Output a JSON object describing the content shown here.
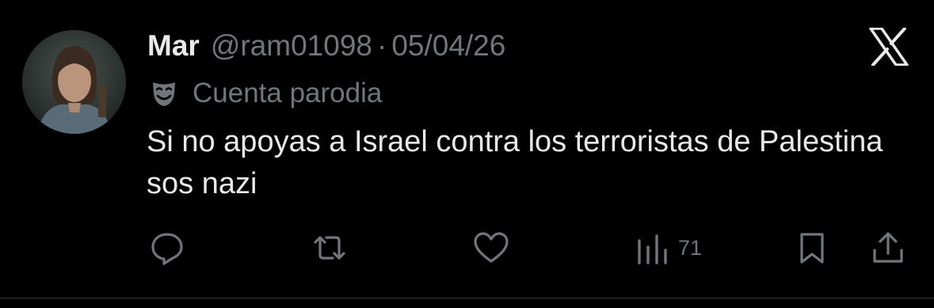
{
  "tweet": {
    "display_name": "Mar",
    "handle": "@ram01098",
    "separator": "·",
    "date": "05/04/26",
    "label": "Cuenta parodia",
    "text": "Si no apoyas a Israel contra los terroristas de Palestina sos nazi"
  },
  "actions": {
    "reply_icon": "reply-icon",
    "retweet_icon": "retweet-icon",
    "like_icon": "heart-icon",
    "views_icon": "views-bar-icon",
    "views_count": "71",
    "bookmark_icon": "bookmark-icon",
    "share_icon": "share-icon"
  },
  "colors": {
    "background": "#000000",
    "primary_text": "#e7e9ea",
    "secondary_text": "#71767b"
  }
}
